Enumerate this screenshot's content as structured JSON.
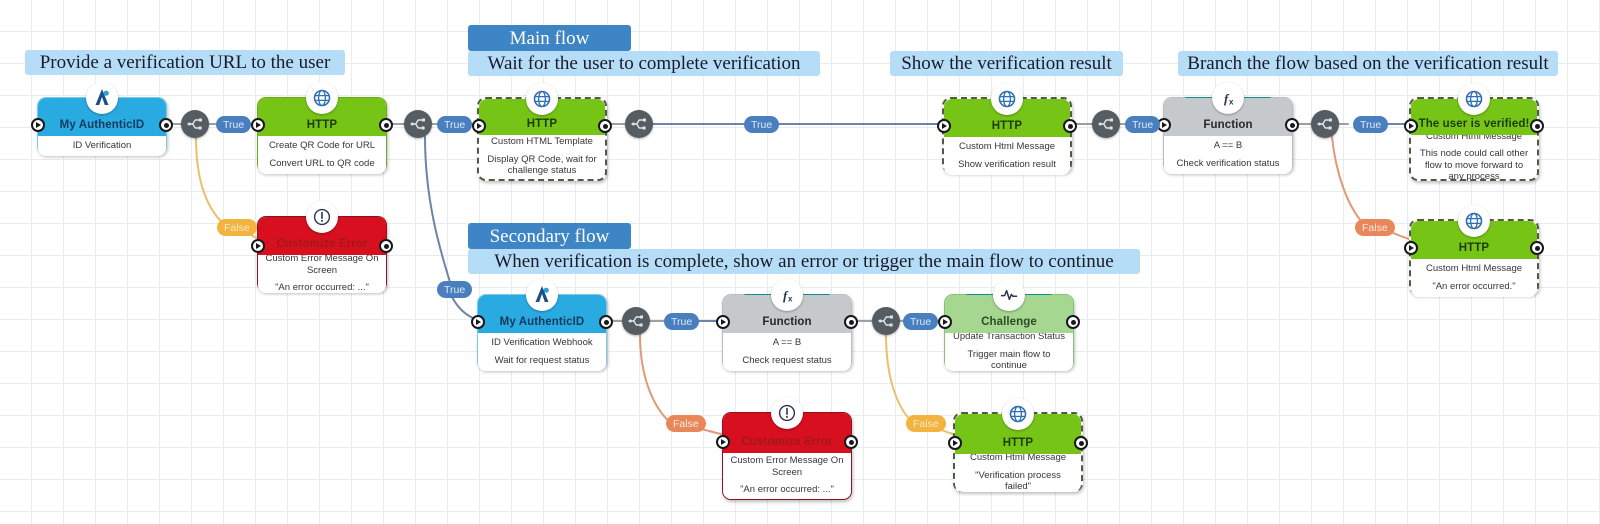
{
  "colors": {
    "banner_light": "#b5ddf7",
    "banner_dark": "#3e85c6",
    "node_auth": "#29abe2",
    "node_http": "#76c516",
    "node_function": "#c6c9cc",
    "node_challenge": "#a5d791",
    "node_error": "#d80f1f",
    "accent_teal": "#118f8f",
    "router": "#555d63",
    "label_true": "#4a7fbf",
    "label_false_yellow": "#f3b33f",
    "label_false_orange": "#e8875a",
    "wire_blue": "#6d84a8",
    "wire_yellow": "#e8c16a",
    "wire_orange": "#e09a78",
    "wire_gray": "#9aa0a6"
  },
  "banners": [
    {
      "id": "provide-url",
      "text": "Provide a verification URL to the user",
      "style": "light"
    },
    {
      "id": "main-flow",
      "text": "Main flow",
      "style": "dark"
    },
    {
      "id": "wait-user",
      "text": "Wait for the user to complete verification",
      "style": "light"
    },
    {
      "id": "show-result",
      "text": "Show the verification result",
      "style": "light"
    },
    {
      "id": "branch-flow",
      "text": "Branch the flow based on the verification result",
      "style": "light"
    },
    {
      "id": "secondary-flow",
      "text": "Secondary flow",
      "style": "dark"
    },
    {
      "id": "when-complete",
      "text": "When verification is complete, show an error or trigger the main flow to continue",
      "style": "light"
    }
  ],
  "nodes": [
    {
      "id": "my-authenticid-1",
      "icon": "authenticid-icon",
      "skin": "skin-auth",
      "title": "My AuthenticID",
      "lines": [
        "ID Verification"
      ],
      "accent": false
    },
    {
      "id": "http-qr-create",
      "icon": "globe-icon",
      "skin": "skin-http",
      "title": "HTTP",
      "lines": [
        "Create QR Code for URL",
        "Convert URL to QR code"
      ],
      "accent": false
    },
    {
      "id": "customize-error-1",
      "icon": "alert-icon",
      "skin": "skin-err",
      "title": "Customize Error",
      "lines": [
        "Custom Error Message On Screen",
        "\"An error occurred: ...\""
      ],
      "accent": false
    },
    {
      "id": "http-qr-display",
      "icon": "globe-icon",
      "skin": "skin-httpdash",
      "title": "HTTP",
      "lines": [
        "Custom HTML Template",
        "Display QR Code, wait for challenge status"
      ],
      "accent": false
    },
    {
      "id": "http-show-result",
      "icon": "globe-icon",
      "skin": "skin-httpdash",
      "title": "HTTP",
      "lines": [
        "Custom Html Message",
        "Show verification result"
      ],
      "accent": false
    },
    {
      "id": "function-verify",
      "icon": "fx-icon",
      "skin": "skin-func",
      "title": "Function",
      "lines": [
        "A == B",
        "Check verification status"
      ],
      "accent": true
    },
    {
      "id": "http-user-verified",
      "icon": "globe-icon",
      "skin": "skin-httpdash",
      "title": "The user is verified!",
      "lines": [
        "Custom Html Message",
        "This node could call other flow to move forward to any process"
      ],
      "accent": false
    },
    {
      "id": "http-error-occurred",
      "icon": "globe-icon",
      "skin": "skin-httpdash",
      "title": "HTTP",
      "lines": [
        "Custom Html Message",
        "\"An error occurred.\""
      ],
      "accent": false
    },
    {
      "id": "my-authenticid-2",
      "icon": "authenticid-icon",
      "skin": "skin-auth",
      "title": "My AuthenticID",
      "lines": [
        "ID Verification Webhook",
        "Wait for request status"
      ],
      "accent": false
    },
    {
      "id": "function-request",
      "icon": "fx-icon",
      "skin": "skin-func",
      "title": "Function",
      "lines": [
        "A == B",
        "Check request status"
      ],
      "accent": true
    },
    {
      "id": "challenge-update",
      "icon": "pulse-icon",
      "skin": "skin-chal",
      "title": "Challenge",
      "lines": [
        "Update Transaction Status",
        "Trigger main flow to continue"
      ],
      "accent": true
    },
    {
      "id": "customize-error-2",
      "icon": "alert-icon",
      "skin": "skin-err",
      "title": "Customize Error",
      "lines": [
        "Custom Error Message On Screen",
        "\"An error occurred: ...\""
      ],
      "accent": false
    },
    {
      "id": "http-verification-failed",
      "icon": "globe-icon",
      "skin": "skin-httpdash",
      "title": "HTTP",
      "lines": [
        "Custom Html Message",
        "\"Verification process failed\""
      ],
      "accent": false
    }
  ],
  "edge_labels": [
    {
      "id": "l1",
      "text": "True",
      "kind": "true"
    },
    {
      "id": "l2",
      "text": "False",
      "kind": "false-y"
    },
    {
      "id": "l3",
      "text": "True",
      "kind": "true"
    },
    {
      "id": "l4",
      "text": "True",
      "kind": "true"
    },
    {
      "id": "l5",
      "text": "True",
      "kind": "true"
    },
    {
      "id": "l6",
      "text": "True",
      "kind": "true"
    },
    {
      "id": "l7",
      "text": "True",
      "kind": "true"
    },
    {
      "id": "l8",
      "text": "False",
      "kind": "false-o"
    },
    {
      "id": "l9",
      "text": "True",
      "kind": "true"
    },
    {
      "id": "l10",
      "text": "False",
      "kind": "false-o"
    },
    {
      "id": "l11",
      "text": "True",
      "kind": "true"
    },
    {
      "id": "l12",
      "text": "False",
      "kind": "false-y"
    }
  ]
}
